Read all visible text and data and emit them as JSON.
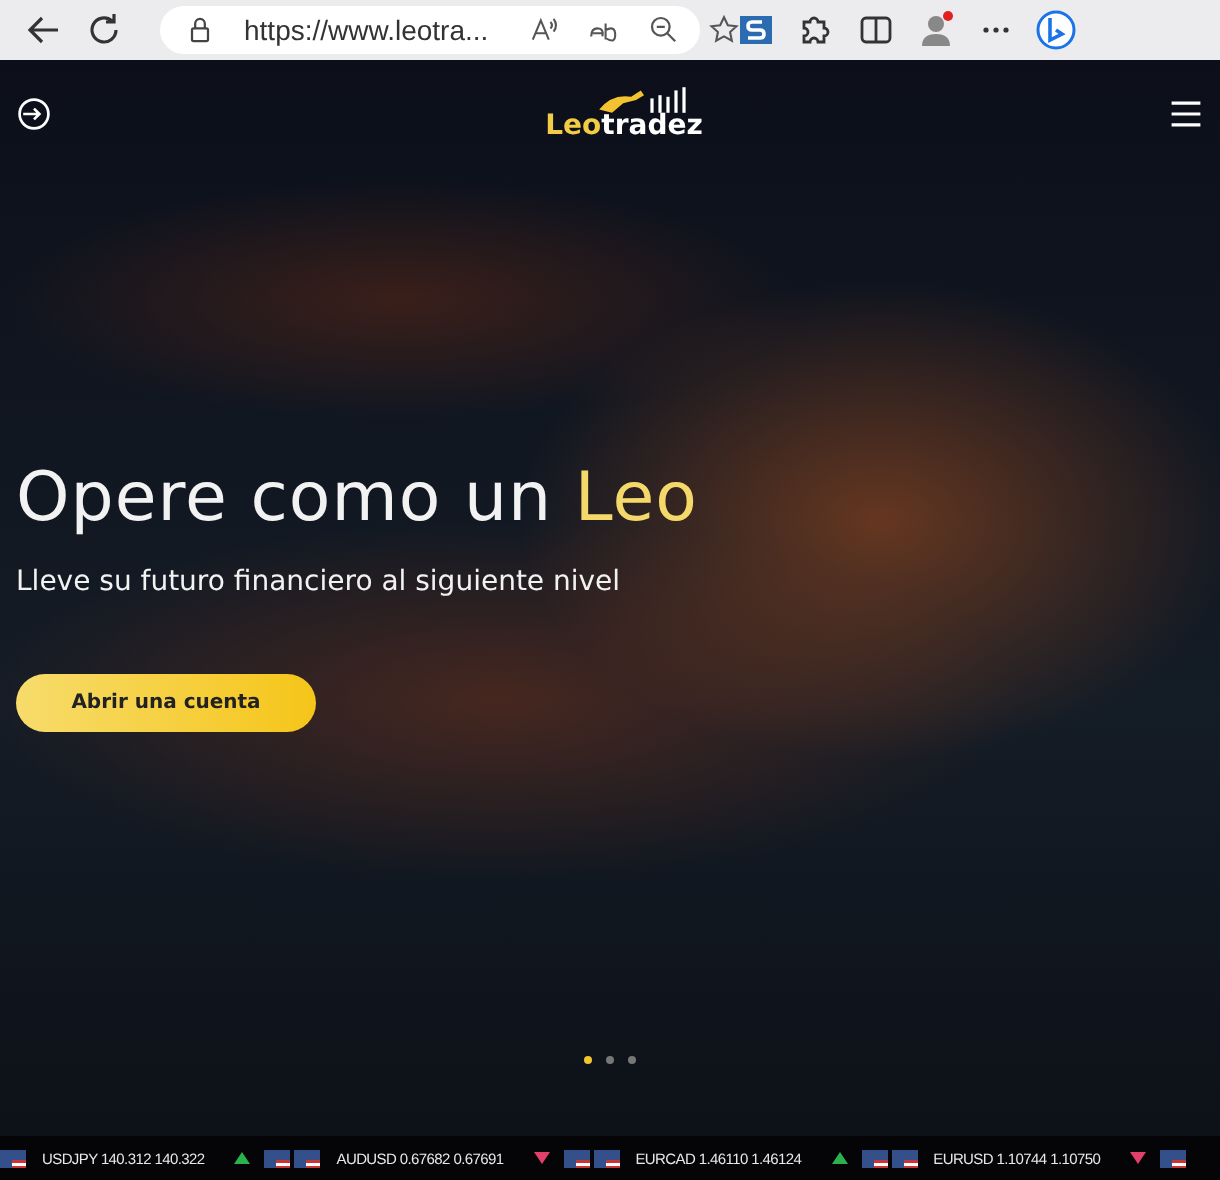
{
  "browser": {
    "url": "https://www.leotra...",
    "profile_notification": true
  },
  "header": {
    "logo_left": "Leo",
    "logo_right": "tradez"
  },
  "hero": {
    "headline": "Opere como un",
    "headline_highlight": "Leo",
    "subtitle": "Lleve su futuro financiero al siguiente nivel",
    "cta": "Abrir una cuenta"
  },
  "carousel_dots": [
    {
      "selected": true
    },
    {
      "selected": false
    },
    {
      "selected": false
    }
  ],
  "ticker": {
    "segments": [
      {
        "kind": "flag"
      },
      {
        "kind": "quote",
        "pair": "USDJPY",
        "bid": "140.312",
        "ask": "140.322"
      },
      {
        "kind": "arrow",
        "up": true
      },
      {
        "kind": "flag"
      },
      {
        "kind": "flag"
      },
      {
        "kind": "quote",
        "pair": "AUDUSD",
        "bid": "0.67682",
        "ask": "0.67691"
      },
      {
        "kind": "arrow",
        "up": false
      },
      {
        "kind": "flag"
      },
      {
        "kind": "flag"
      },
      {
        "kind": "quote",
        "pair": "EURCAD",
        "bid": "1.46110",
        "ask": "1.46124"
      },
      {
        "kind": "arrow",
        "up": true
      },
      {
        "kind": "flag"
      },
      {
        "kind": "flag"
      },
      {
        "kind": "quote",
        "pair": "EURUSD",
        "bid": "1.10744",
        "ask": "1.10750"
      },
      {
        "kind": "arrow",
        "up": false
      },
      {
        "kind": "flag"
      }
    ]
  }
}
